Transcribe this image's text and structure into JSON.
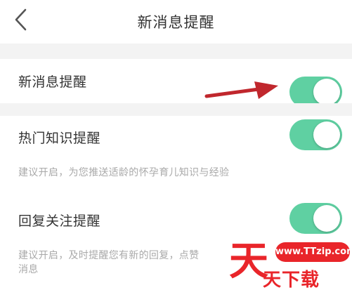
{
  "header": {
    "back_icon": "chevron-left-icon",
    "title": "新消息提醒"
  },
  "settings": [
    {
      "label": "新消息提醒",
      "enabled": true,
      "description": ""
    },
    {
      "label": "热门知识提醒",
      "enabled": true,
      "description": "建议开启，为您推送适龄的怀孕育儿知识与经验"
    },
    {
      "label": "回复关注提醒",
      "enabled": true,
      "description_line1": "建议开启，及时提醒您有新的回复，点赞",
      "description_line2": "消息"
    }
  ],
  "watermark": {
    "big_char": "天",
    "pill": "www.TTzip.com",
    "text": "天下载"
  },
  "colors": {
    "toggle_on": "#5fd0a2",
    "arrow": "#c0272d",
    "watermark": "#e9252a"
  }
}
